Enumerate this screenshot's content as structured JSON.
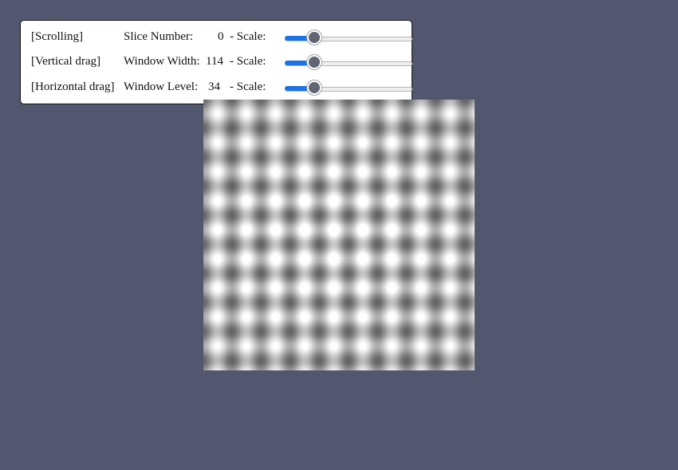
{
  "controls": {
    "rows": [
      {
        "mode": "[Scrolling]",
        "param_label": "Slice Number:",
        "value": "0",
        "scale_label": "- Scale:",
        "slider_fraction": 0.23
      },
      {
        "mode": "[Vertical drag]",
        "param_label": "Window Width:",
        "value": "114",
        "scale_label": "- Scale:",
        "slider_fraction": 0.23
      },
      {
        "mode": "[Horizontal drag]",
        "param_label": "Window Level:",
        "value": "34",
        "scale_label": "- Scale:",
        "slider_fraction": 0.23
      }
    ]
  },
  "colors": {
    "background": "#52566e",
    "slider_accent": "#1a73e8",
    "slider_thumb": "#616673"
  }
}
